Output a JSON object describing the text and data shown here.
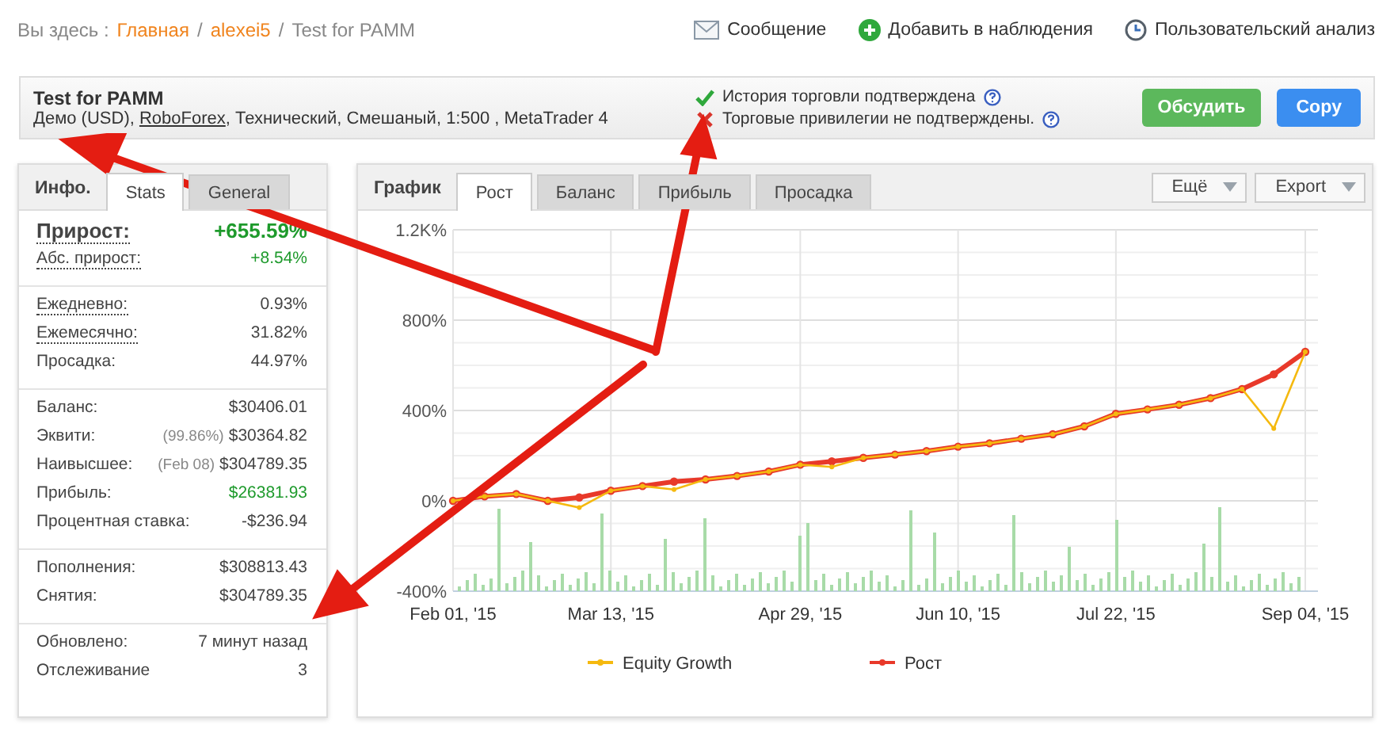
{
  "breadcrumb": {
    "prefix": "Вы здесь :",
    "links": [
      "Главная",
      "alexei5"
    ],
    "separator": "/",
    "current": "Test for PAMM"
  },
  "top_actions": [
    {
      "kind": "message",
      "label": "Сообщение"
    },
    {
      "kind": "watch",
      "label": "Добавить в наблюдения"
    },
    {
      "kind": "analysis",
      "label": "Пользовательский анализ"
    }
  ],
  "account": {
    "title": "Test for PAMM",
    "details_prefix": "Демо (USD), ",
    "broker": "RoboForex",
    "details_suffix": ", Технический, Смешаный, 1:500 , MetaTrader 4",
    "statuses": [
      {
        "text": "История торговли подтверждена",
        "verified": true
      },
      {
        "text": "Торговые привилегии не подтверждены.",
        "verified": false
      }
    ],
    "buttons": [
      {
        "kind": "discuss",
        "label": "Обсудить"
      },
      {
        "kind": "copy",
        "label": "Copy"
      }
    ]
  },
  "stats_panel": {
    "title": "Инфо.",
    "tabs": [
      {
        "label": "Stats",
        "selected": true
      },
      {
        "label": "General",
        "selected": false
      }
    ],
    "groups": [
      [
        {
          "label": "Прирост:",
          "value": "+655.59%",
          "headline": true,
          "dotted": true,
          "positive": true
        },
        {
          "label": "Абс. прирост:",
          "value": "+8.54%",
          "headline": false,
          "dotted": true,
          "positive": true
        }
      ],
      [
        {
          "label": "Ежедневно:",
          "value": "0.93%",
          "headline": false,
          "dotted": true,
          "positive": false
        },
        {
          "label": "Ежемесячно:",
          "value": "31.82%",
          "headline": false,
          "dotted": true,
          "positive": false
        },
        {
          "label": "Просадка:",
          "value": "44.97%",
          "headline": false,
          "dotted": false,
          "positive": false
        }
      ],
      [
        {
          "label": "Баланс:",
          "value": "$30406.01",
          "headline": false,
          "dotted": false,
          "positive": false
        },
        {
          "label": "Эквити:",
          "note": "(99.86%)",
          "value": "$30364.82",
          "headline": false,
          "dotted": false,
          "positive": false
        },
        {
          "label": "Наивысшее:",
          "note": "(Feb 08)",
          "value": "$304789.35",
          "headline": false,
          "dotted": false,
          "positive": false
        },
        {
          "label": "Прибыль:",
          "value": "$26381.93",
          "headline": false,
          "dotted": false,
          "positive": true
        },
        {
          "label": "Процентная ставка:",
          "value": "-$236.94",
          "headline": false,
          "dotted": false,
          "positive": false
        }
      ],
      [
        {
          "label": "Пополнения:",
          "value": "$308813.43",
          "headline": false,
          "dotted": false,
          "positive": false
        },
        {
          "label": "Снятия:",
          "value": "$304789.35",
          "headline": false,
          "dotted": false,
          "positive": false
        }
      ],
      [
        {
          "label": "Обновлено:",
          "value": "7 минут назад",
          "headline": false,
          "dotted": false,
          "positive": false
        },
        {
          "label": "Отслеживание",
          "value": "3",
          "headline": false,
          "dotted": false,
          "positive": false
        }
      ]
    ]
  },
  "chart_panel": {
    "title": "График",
    "tabs": [
      {
        "label": "Рост",
        "selected": true
      },
      {
        "label": "Баланс",
        "selected": false
      },
      {
        "label": "Прибыль",
        "selected": false
      },
      {
        "label": "Просадка",
        "selected": false
      }
    ],
    "menus": [
      "Ещё",
      "Export"
    ],
    "chart_data": {
      "type": "line",
      "categories": [
        "Feb 01, '15",
        null,
        null,
        null,
        null,
        "Mar 13, '15",
        null,
        null,
        null,
        null,
        null,
        "Apr 29, '15",
        null,
        null,
        null,
        null,
        "Jun 10, '15",
        null,
        null,
        null,
        null,
        "Jul 22, '15",
        null,
        null,
        null,
        null,
        null,
        "Sep 04, '15"
      ],
      "ylim": [
        -400,
        1200
      ],
      "grid": true,
      "legend": true,
      "yticks": [
        {
          "value": -400,
          "label": "-400%"
        },
        {
          "value": 0,
          "label": "0%"
        },
        {
          "value": 400,
          "label": "400%"
        },
        {
          "value": 800,
          "label": "800%"
        },
        {
          "value": 1200,
          "label": "1.2K%"
        }
      ],
      "series": [
        {
          "name": "Equity Growth",
          "color": "#f5b90f",
          "values": [
            0,
            20,
            30,
            0,
            -30,
            45,
            65,
            50,
            95,
            110,
            130,
            160,
            150,
            190,
            205,
            220,
            240,
            255,
            275,
            295,
            330,
            385,
            405,
            425,
            455,
            495,
            320,
            660
          ]
        },
        {
          "name": "Рост",
          "color": "#e8392a",
          "values": [
            0,
            20,
            30,
            0,
            15,
            45,
            65,
            85,
            95,
            110,
            130,
            160,
            175,
            190,
            205,
            220,
            240,
            255,
            275,
            295,
            330,
            385,
            405,
            425,
            455,
            495,
            560,
            660
          ]
        }
      ]
    }
  }
}
